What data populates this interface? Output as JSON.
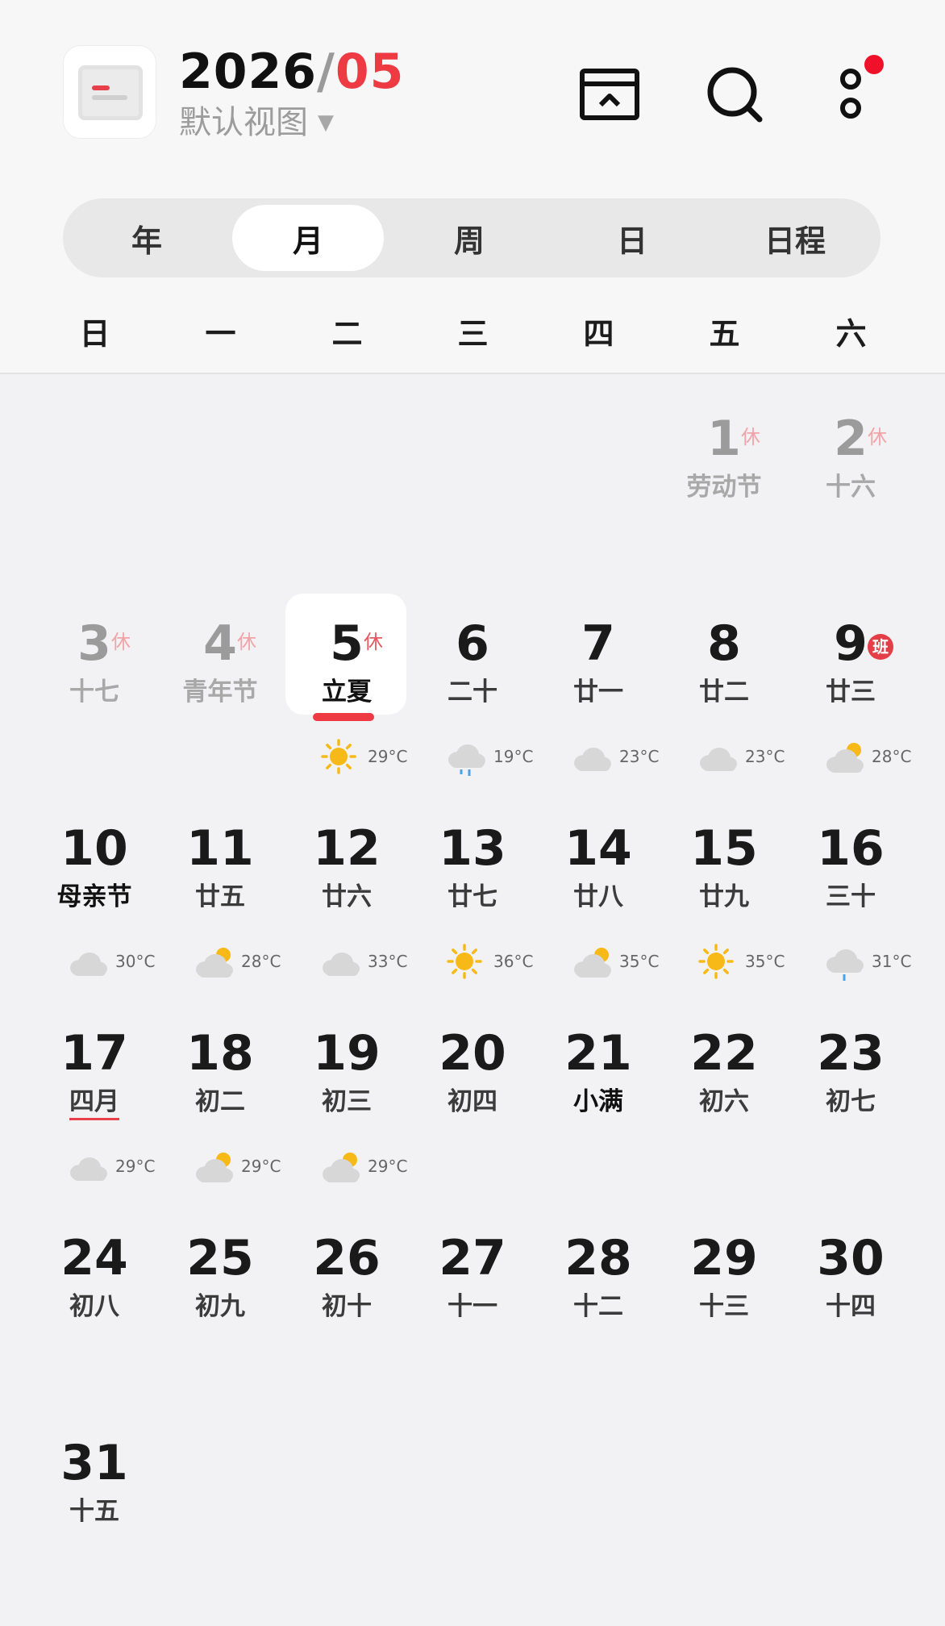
{
  "header": {
    "year": "2026",
    "slash": "/",
    "month": "05",
    "view_label": "默认视图",
    "view_arrow": "▼",
    "icons": [
      "archive-icon",
      "search-icon",
      "more-icon"
    ],
    "notification_dot_color": "#f0102a"
  },
  "tabs": [
    {
      "label": "年",
      "active": false
    },
    {
      "label": "月",
      "active": true
    },
    {
      "label": "周",
      "active": false
    },
    {
      "label": "日",
      "active": false
    },
    {
      "label": "日程",
      "active": false
    }
  ],
  "weekdays": [
    "日",
    "一",
    "二",
    "三",
    "四",
    "五",
    "六"
  ],
  "days": [
    {
      "day": "1",
      "lunar": "劳动节",
      "badge": "休",
      "dim": true
    },
    {
      "day": "2",
      "lunar": "十六",
      "badge": "休",
      "dim": true
    },
    {
      "day": "3",
      "lunar": "十七",
      "badge": "休",
      "dim": true
    },
    {
      "day": "4",
      "lunar": "青年节",
      "badge": "休",
      "dim": true
    },
    {
      "day": "5",
      "lunar": "立夏",
      "badge": "休",
      "today": true,
      "weather": "sun-icon",
      "temp": "29°C"
    },
    {
      "day": "6",
      "lunar": "二十",
      "weather": "rain-icon",
      "temp": "19°C"
    },
    {
      "day": "7",
      "lunar": "廿一",
      "weather": "cloud-icon",
      "temp": "23°C"
    },
    {
      "day": "8",
      "lunar": "廿二",
      "weather": "cloud-icon",
      "temp": "23°C"
    },
    {
      "day": "9",
      "lunar": "廿三",
      "work": "班",
      "weather": "partly-cloudy-icon",
      "temp": "28°C"
    },
    {
      "day": "10",
      "lunar": "母亲节",
      "strong": true,
      "weather": "cloud-icon",
      "temp": "30°C"
    },
    {
      "day": "11",
      "lunar": "廿五",
      "weather": "partly-cloudy-icon",
      "temp": "28°C"
    },
    {
      "day": "12",
      "lunar": "廿六",
      "weather": "cloud-icon",
      "temp": "33°C"
    },
    {
      "day": "13",
      "lunar": "廿七",
      "weather": "sun-icon",
      "temp": "36°C"
    },
    {
      "day": "14",
      "lunar": "廿八",
      "weather": "partly-cloudy-icon",
      "temp": "35°C"
    },
    {
      "day": "15",
      "lunar": "廿九",
      "weather": "sun-icon",
      "temp": "35°C"
    },
    {
      "day": "16",
      "lunar": "三十",
      "weather": "drizzle-icon",
      "temp": "31°C"
    },
    {
      "day": "17",
      "lunar": "四月",
      "underline": true,
      "weather": "cloud-icon",
      "temp": "29°C"
    },
    {
      "day": "18",
      "lunar": "初二",
      "weather": "partly-cloudy-icon",
      "temp": "29°C"
    },
    {
      "day": "19",
      "lunar": "初三",
      "weather": "partly-cloudy-icon",
      "temp": "29°C"
    },
    {
      "day": "20",
      "lunar": "初四"
    },
    {
      "day": "21",
      "lunar": "小满",
      "strong": true
    },
    {
      "day": "22",
      "lunar": "初六"
    },
    {
      "day": "23",
      "lunar": "初七"
    },
    {
      "day": "24",
      "lunar": "初八"
    },
    {
      "day": "25",
      "lunar": "初九"
    },
    {
      "day": "26",
      "lunar": "初十"
    },
    {
      "day": "27",
      "lunar": "十一"
    },
    {
      "day": "28",
      "lunar": "十二"
    },
    {
      "day": "29",
      "lunar": "十三"
    },
    {
      "day": "30",
      "lunar": "十四"
    },
    {
      "day": "31",
      "lunar": "十五"
    }
  ],
  "colors": {
    "accent": "#ee3a43",
    "sun": "#f6b917",
    "cloud": "#d7d7d7",
    "rain": "#4aa3e8"
  }
}
